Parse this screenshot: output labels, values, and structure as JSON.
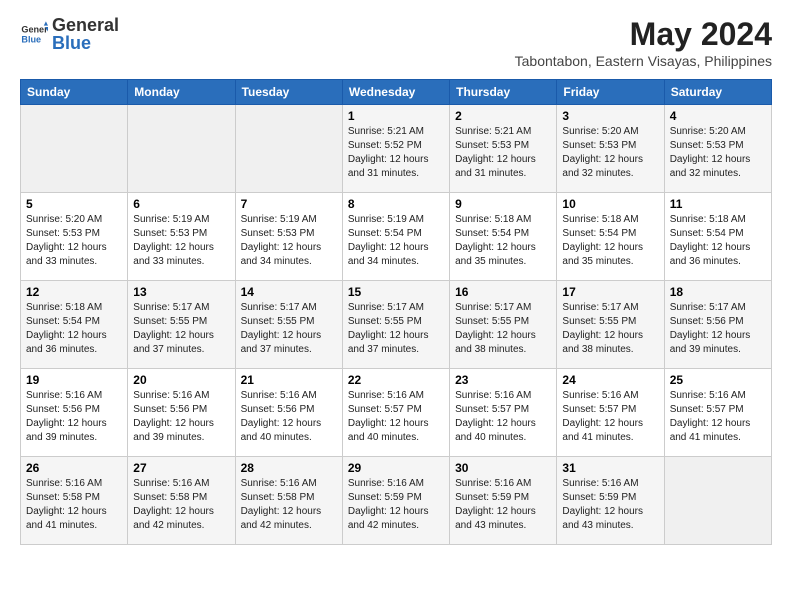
{
  "header": {
    "logo_general": "General",
    "logo_blue": "Blue",
    "month_year": "May 2024",
    "location": "Tabontabon, Eastern Visayas, Philippines"
  },
  "calendar": {
    "days_of_week": [
      "Sunday",
      "Monday",
      "Tuesday",
      "Wednesday",
      "Thursday",
      "Friday",
      "Saturday"
    ],
    "weeks": [
      [
        {
          "day": "",
          "info": ""
        },
        {
          "day": "",
          "info": ""
        },
        {
          "day": "",
          "info": ""
        },
        {
          "day": "1",
          "info": "Sunrise: 5:21 AM\nSunset: 5:52 PM\nDaylight: 12 hours\nand 31 minutes."
        },
        {
          "day": "2",
          "info": "Sunrise: 5:21 AM\nSunset: 5:53 PM\nDaylight: 12 hours\nand 31 minutes."
        },
        {
          "day": "3",
          "info": "Sunrise: 5:20 AM\nSunset: 5:53 PM\nDaylight: 12 hours\nand 32 minutes."
        },
        {
          "day": "4",
          "info": "Sunrise: 5:20 AM\nSunset: 5:53 PM\nDaylight: 12 hours\nand 32 minutes."
        }
      ],
      [
        {
          "day": "5",
          "info": "Sunrise: 5:20 AM\nSunset: 5:53 PM\nDaylight: 12 hours\nand 33 minutes."
        },
        {
          "day": "6",
          "info": "Sunrise: 5:19 AM\nSunset: 5:53 PM\nDaylight: 12 hours\nand 33 minutes."
        },
        {
          "day": "7",
          "info": "Sunrise: 5:19 AM\nSunset: 5:53 PM\nDaylight: 12 hours\nand 34 minutes."
        },
        {
          "day": "8",
          "info": "Sunrise: 5:19 AM\nSunset: 5:54 PM\nDaylight: 12 hours\nand 34 minutes."
        },
        {
          "day": "9",
          "info": "Sunrise: 5:18 AM\nSunset: 5:54 PM\nDaylight: 12 hours\nand 35 minutes."
        },
        {
          "day": "10",
          "info": "Sunrise: 5:18 AM\nSunset: 5:54 PM\nDaylight: 12 hours\nand 35 minutes."
        },
        {
          "day": "11",
          "info": "Sunrise: 5:18 AM\nSunset: 5:54 PM\nDaylight: 12 hours\nand 36 minutes."
        }
      ],
      [
        {
          "day": "12",
          "info": "Sunrise: 5:18 AM\nSunset: 5:54 PM\nDaylight: 12 hours\nand 36 minutes."
        },
        {
          "day": "13",
          "info": "Sunrise: 5:17 AM\nSunset: 5:55 PM\nDaylight: 12 hours\nand 37 minutes."
        },
        {
          "day": "14",
          "info": "Sunrise: 5:17 AM\nSunset: 5:55 PM\nDaylight: 12 hours\nand 37 minutes."
        },
        {
          "day": "15",
          "info": "Sunrise: 5:17 AM\nSunset: 5:55 PM\nDaylight: 12 hours\nand 37 minutes."
        },
        {
          "day": "16",
          "info": "Sunrise: 5:17 AM\nSunset: 5:55 PM\nDaylight: 12 hours\nand 38 minutes."
        },
        {
          "day": "17",
          "info": "Sunrise: 5:17 AM\nSunset: 5:55 PM\nDaylight: 12 hours\nand 38 minutes."
        },
        {
          "day": "18",
          "info": "Sunrise: 5:17 AM\nSunset: 5:56 PM\nDaylight: 12 hours\nand 39 minutes."
        }
      ],
      [
        {
          "day": "19",
          "info": "Sunrise: 5:16 AM\nSunset: 5:56 PM\nDaylight: 12 hours\nand 39 minutes."
        },
        {
          "day": "20",
          "info": "Sunrise: 5:16 AM\nSunset: 5:56 PM\nDaylight: 12 hours\nand 39 minutes."
        },
        {
          "day": "21",
          "info": "Sunrise: 5:16 AM\nSunset: 5:56 PM\nDaylight: 12 hours\nand 40 minutes."
        },
        {
          "day": "22",
          "info": "Sunrise: 5:16 AM\nSunset: 5:57 PM\nDaylight: 12 hours\nand 40 minutes."
        },
        {
          "day": "23",
          "info": "Sunrise: 5:16 AM\nSunset: 5:57 PM\nDaylight: 12 hours\nand 40 minutes."
        },
        {
          "day": "24",
          "info": "Sunrise: 5:16 AM\nSunset: 5:57 PM\nDaylight: 12 hours\nand 41 minutes."
        },
        {
          "day": "25",
          "info": "Sunrise: 5:16 AM\nSunset: 5:57 PM\nDaylight: 12 hours\nand 41 minutes."
        }
      ],
      [
        {
          "day": "26",
          "info": "Sunrise: 5:16 AM\nSunset: 5:58 PM\nDaylight: 12 hours\nand 41 minutes."
        },
        {
          "day": "27",
          "info": "Sunrise: 5:16 AM\nSunset: 5:58 PM\nDaylight: 12 hours\nand 42 minutes."
        },
        {
          "day": "28",
          "info": "Sunrise: 5:16 AM\nSunset: 5:58 PM\nDaylight: 12 hours\nand 42 minutes."
        },
        {
          "day": "29",
          "info": "Sunrise: 5:16 AM\nSunset: 5:59 PM\nDaylight: 12 hours\nand 42 minutes."
        },
        {
          "day": "30",
          "info": "Sunrise: 5:16 AM\nSunset: 5:59 PM\nDaylight: 12 hours\nand 43 minutes."
        },
        {
          "day": "31",
          "info": "Sunrise: 5:16 AM\nSunset: 5:59 PM\nDaylight: 12 hours\nand 43 minutes."
        },
        {
          "day": "",
          "info": ""
        }
      ]
    ]
  }
}
